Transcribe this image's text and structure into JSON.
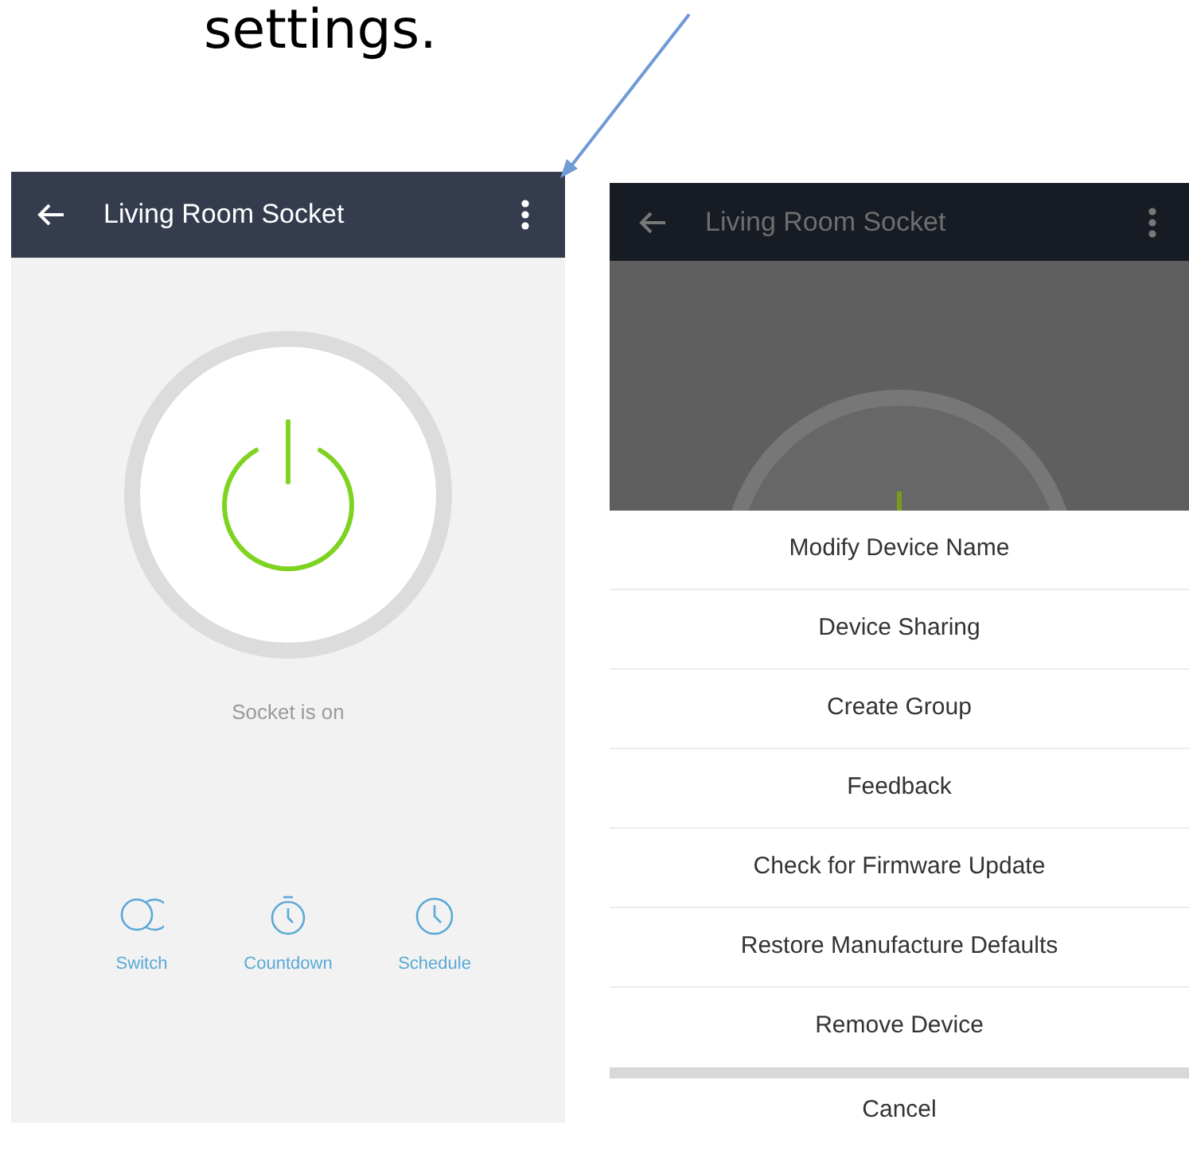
{
  "heading": "settings.",
  "left_screen": {
    "title": "Living Room Socket",
    "power_on": true,
    "status": "Socket is on",
    "actions": [
      {
        "label": "Switch",
        "kind": "switch"
      },
      {
        "label": "Countdown",
        "kind": "countdown"
      },
      {
        "label": "Schedule",
        "kind": "schedule"
      }
    ]
  },
  "right_screen": {
    "title": "Living Room Socket",
    "menu": [
      "Modify Device Name",
      "Device Sharing",
      "Create Group",
      "Feedback",
      "Check for Firmware Update",
      "Restore Manufacture Defaults",
      "Remove Device"
    ],
    "cancel": "Cancel"
  }
}
